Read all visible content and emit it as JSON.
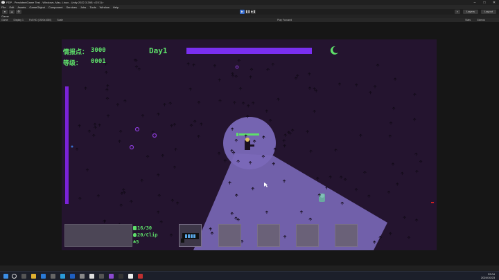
{
  "window": {
    "title": "PDP - PersistentGame Test - Windows, Mac, Linux - Unity 2022.3.28f1 <DX11>",
    "controls": [
      "–",
      "□",
      "✕"
    ]
  },
  "menu": [
    "File",
    "Edit",
    "Assets",
    "GameObject",
    "Component",
    "Services",
    "Jobs",
    "Tools",
    "Window",
    "Help"
  ],
  "toolbar": {
    "play_buttons": [
      "▶",
      "❚❚",
      "▶❚"
    ],
    "layers_label": "Layers",
    "layout_label": "Layout"
  },
  "tab": {
    "label": "Game"
  },
  "game_bar": {
    "mode": "Game",
    "display": "Display 1",
    "resolution": "Full HD (1920x1080)",
    "scale": "Scale",
    "play_focused": "Play Focused",
    "stats": "Stats",
    "gizmos": "Gizmos"
  },
  "hud": {
    "intel_label": "情报点：",
    "intel_value": "3000",
    "level_label": "等级：",
    "level_value": "0001",
    "day_label": "Day1",
    "ammo_magazine": "16/30",
    "ammo_clip": "20/Clip",
    "grenades": "5",
    "day_progress": 1.0,
    "left_meter": 1.0
  },
  "colors": {
    "hud_green": "#5ee06a",
    "day_bar": "#7a2ff0",
    "background": "#24142f",
    "flashlight": "#7a68b8"
  },
  "taskbar": {
    "time": "22:04",
    "date": "2024/10/23"
  }
}
